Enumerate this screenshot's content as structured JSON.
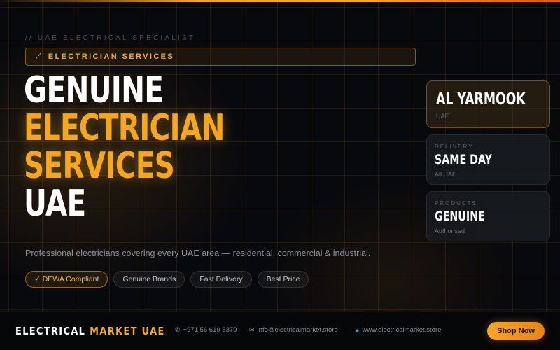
{
  "hero": {
    "eyebrow": "// UAE ELECTRICAL SPECIALIST",
    "badge": {
      "icon": "wrench-icon",
      "label": "ELECTRICIAN SERVICES"
    },
    "headline": [
      "GENUINE",
      "ELECTRICIAN",
      "SERVICES",
      "UAE"
    ],
    "lead": "Professional electricians covering every UAE area — residential, commercial & industrial.",
    "chips": [
      "✓ DEWA Compliant",
      "Genuine Brands",
      "Fast Delivery",
      "Best Price"
    ]
  },
  "cards": [
    {
      "kicker": "",
      "value": "AL YARMOOK",
      "sub": "UAE"
    },
    {
      "kicker": "DELIVERY",
      "value": "SAME DAY",
      "sub": "All UAE"
    },
    {
      "kicker": "PRODUCTS",
      "value": "GENUINE",
      "sub": "Authorised"
    }
  ],
  "footer": {
    "brand_1": "ELECTRICAL",
    "brand_2": "MARKET UAE",
    "phone": "+971 56 619 6379",
    "email": "info@electricalmarket.store",
    "website": "www.electricalmarket.store",
    "cta": "Shop Now"
  },
  "colors": {
    "accent": "#f5a623",
    "background": "#08090d",
    "muted_text": "#8d919a"
  }
}
